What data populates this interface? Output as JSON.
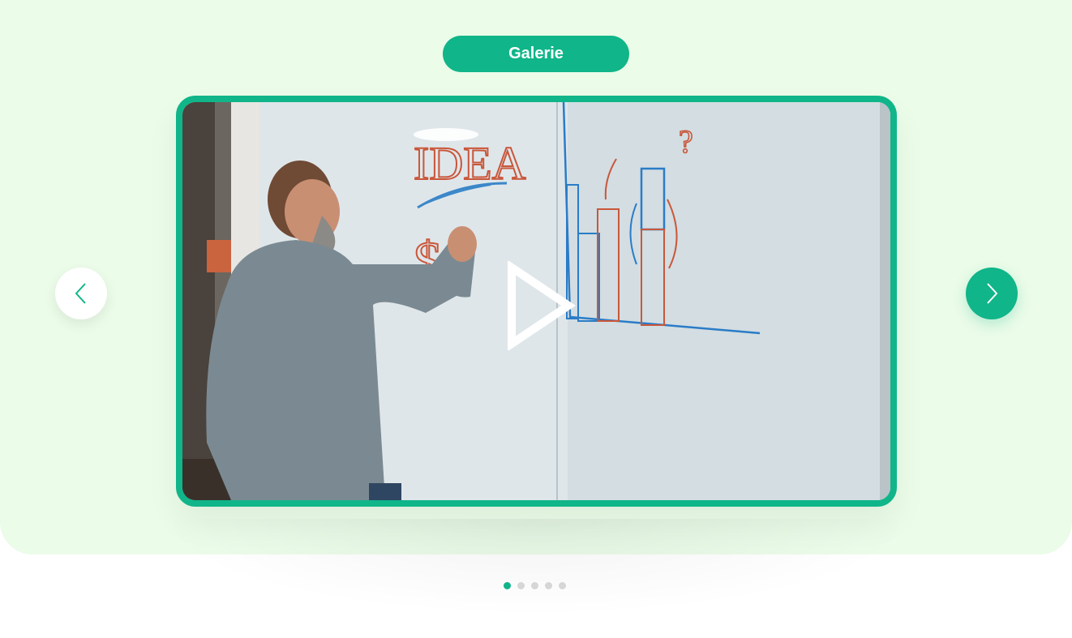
{
  "gallery": {
    "title": "Galerie",
    "accent_color": "#10b589",
    "background_color": "#ebfce9",
    "video": {
      "play_icon": "play-icon"
    },
    "nav": {
      "prev_icon": "chevron-left-icon",
      "next_icon": "chevron-right-icon"
    },
    "pagination": {
      "total": 5,
      "active_index": 0
    }
  }
}
